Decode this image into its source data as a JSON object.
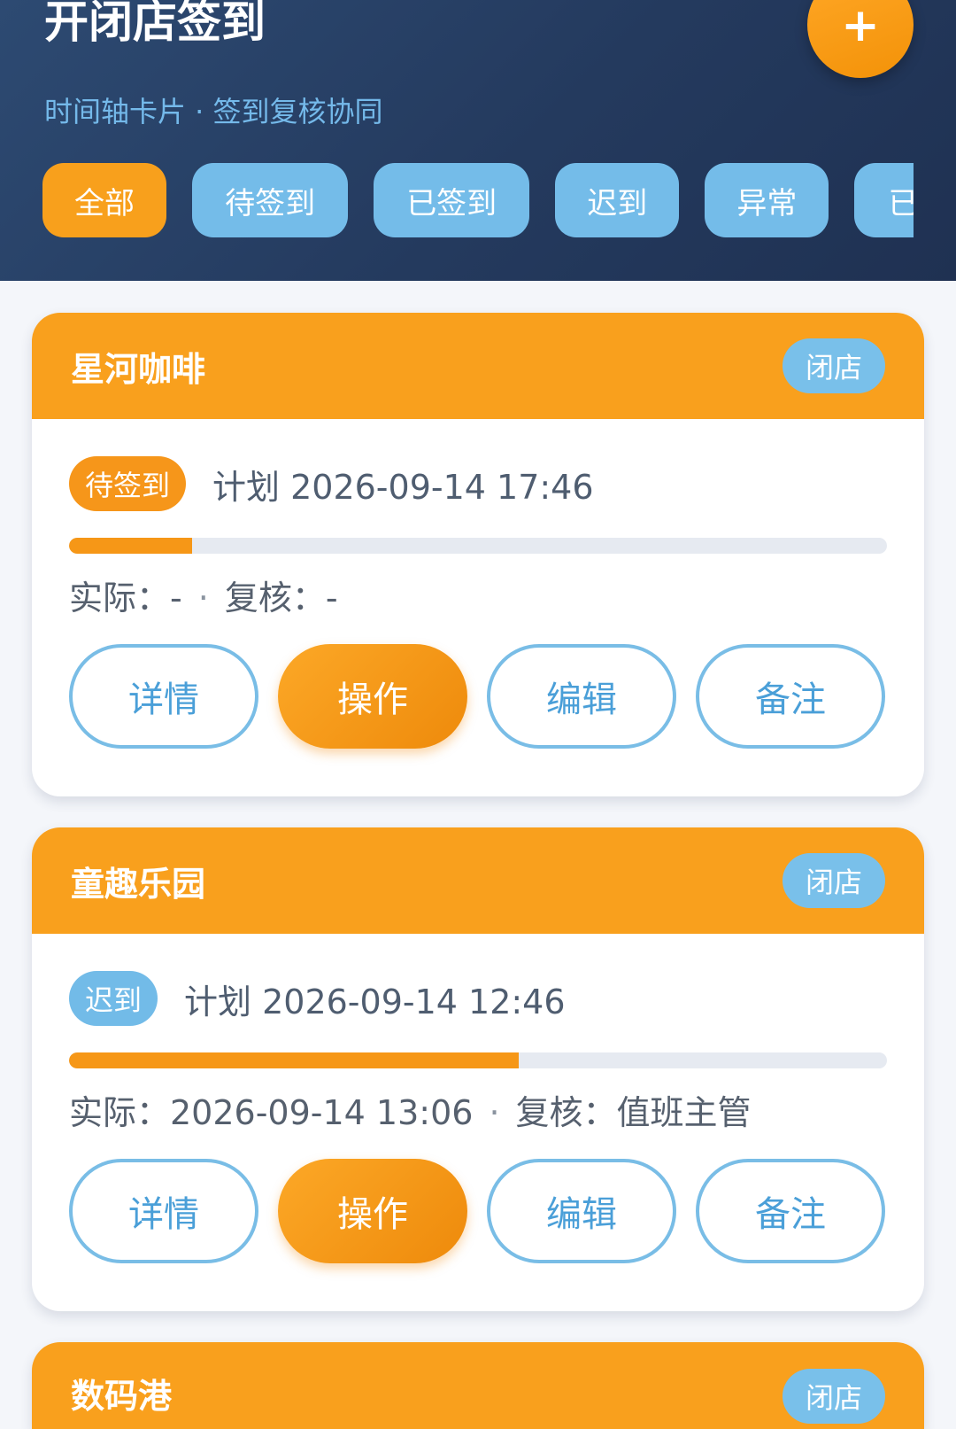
{
  "header": {
    "title": "开闭店签到",
    "subtitle": "时间轴卡片 · 签到复核协同",
    "add_label": "+"
  },
  "filters": [
    {
      "label": "全部",
      "active": true
    },
    {
      "label": "待签到",
      "active": false
    },
    {
      "label": "已签到",
      "active": false
    },
    {
      "label": "迟到",
      "active": false
    },
    {
      "label": "异常",
      "active": false
    },
    {
      "label": "已",
      "active": false
    }
  ],
  "cards": [
    {
      "store": "星河咖啡",
      "type": "闭店",
      "status": "待签到",
      "plan": "计划 2026-09-14 17:46",
      "progress": 0.15,
      "actual": "实际：-",
      "reviewer": "复核：-",
      "actions": [
        "详情",
        "操作",
        "编辑",
        "备注"
      ]
    },
    {
      "store": "童趣乐园",
      "type": "闭店",
      "status": "迟到",
      "plan": "计划 2026-09-14 12:46",
      "progress": 0.55,
      "actual": "实际：2026-09-14 13:06",
      "reviewer": "复核：值班主管",
      "actions": [
        "详情",
        "操作",
        "编辑",
        "备注"
      ]
    },
    {
      "store": "数码港",
      "type": "闭店"
    }
  ],
  "meta_separator": "·",
  "colors": {
    "accent": "#f9a01d",
    "header_bg": "#243a5e",
    "chip": "#74bce9",
    "outline": "#79bde6"
  }
}
